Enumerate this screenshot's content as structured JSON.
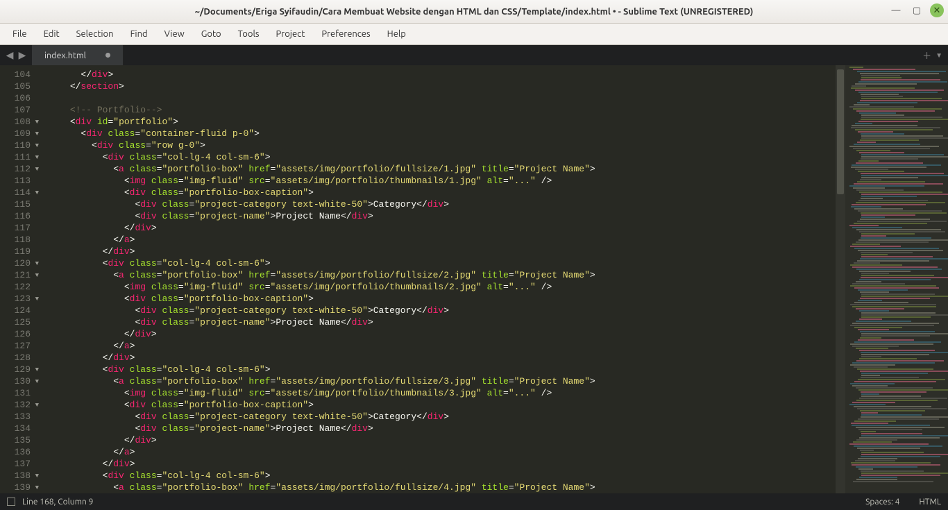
{
  "title": "~/Documents/Eriga Syifaudin/Cara Membuat Website dengan HTML dan CSS/Template/index.html • - Sublime Text (UNREGISTERED)",
  "menu": [
    "File",
    "Edit",
    "Selection",
    "Find",
    "View",
    "Goto",
    "Tools",
    "Project",
    "Preferences",
    "Help"
  ],
  "tab": {
    "name": "index.html"
  },
  "status": {
    "left": "Line 168, Column 9",
    "spaces": "Spaces: 4",
    "lang": "HTML"
  },
  "lineStart": 104,
  "lineEnd": 139,
  "code": [
    {
      "i": 104,
      "indent": 8,
      "t": [
        {
          "p": "</"
        },
        {
          "tg": "div"
        },
        {
          "p": ">"
        }
      ]
    },
    {
      "i": 105,
      "indent": 6,
      "t": [
        {
          "p": "</"
        },
        {
          "tg": "section"
        },
        {
          "p": ">"
        }
      ]
    },
    {
      "i": 106,
      "indent": 0,
      "t": []
    },
    {
      "i": 107,
      "indent": 6,
      "t": [
        {
          "cm": "<!-- Portfolio-->"
        }
      ]
    },
    {
      "i": 108,
      "indent": 6,
      "fold": true,
      "t": [
        {
          "p": "<"
        },
        {
          "tg": "div"
        },
        {
          "p": " "
        },
        {
          "at": "id"
        },
        {
          "p": "="
        },
        {
          "st": "\"portfolio\""
        },
        {
          "p": ">"
        }
      ]
    },
    {
      "i": 109,
      "indent": 8,
      "fold": true,
      "t": [
        {
          "p": "<"
        },
        {
          "tg": "div"
        },
        {
          "p": " "
        },
        {
          "at": "class"
        },
        {
          "p": "="
        },
        {
          "st": "\"container-fluid p-0\""
        },
        {
          "p": ">"
        }
      ]
    },
    {
      "i": 110,
      "indent": 10,
      "fold": true,
      "t": [
        {
          "p": "<"
        },
        {
          "tg": "div"
        },
        {
          "p": " "
        },
        {
          "at": "class"
        },
        {
          "p": "="
        },
        {
          "st": "\"row g-0\""
        },
        {
          "p": ">"
        }
      ]
    },
    {
      "i": 111,
      "indent": 12,
      "fold": true,
      "t": [
        {
          "p": "<"
        },
        {
          "tg": "div"
        },
        {
          "p": " "
        },
        {
          "at": "class"
        },
        {
          "p": "="
        },
        {
          "st": "\"col-lg-4 col-sm-6\""
        },
        {
          "p": ">"
        }
      ]
    },
    {
      "i": 112,
      "indent": 14,
      "fold": true,
      "t": [
        {
          "p": "<"
        },
        {
          "tg": "a"
        },
        {
          "p": " "
        },
        {
          "at": "class"
        },
        {
          "p": "="
        },
        {
          "st": "\"portfolio-box\""
        },
        {
          "p": " "
        },
        {
          "at": "href"
        },
        {
          "p": "="
        },
        {
          "st": "\"assets/img/portfolio/fullsize/1.jpg\""
        },
        {
          "p": " "
        },
        {
          "at": "title"
        },
        {
          "p": "="
        },
        {
          "st": "\"Project Name\""
        },
        {
          "p": ">"
        }
      ]
    },
    {
      "i": 113,
      "indent": 16,
      "t": [
        {
          "p": "<"
        },
        {
          "tg": "img"
        },
        {
          "p": " "
        },
        {
          "at": "class"
        },
        {
          "p": "="
        },
        {
          "st": "\"img-fluid\""
        },
        {
          "p": " "
        },
        {
          "at": "src"
        },
        {
          "p": "="
        },
        {
          "st": "\"assets/img/portfolio/thumbnails/1.jpg\""
        },
        {
          "p": " "
        },
        {
          "at": "alt"
        },
        {
          "p": "="
        },
        {
          "st": "\"...\""
        },
        {
          "p": " />"
        }
      ]
    },
    {
      "i": 114,
      "indent": 16,
      "fold": true,
      "t": [
        {
          "p": "<"
        },
        {
          "tg": "div"
        },
        {
          "p": " "
        },
        {
          "at": "class"
        },
        {
          "p": "="
        },
        {
          "st": "\"portfolio-box-caption\""
        },
        {
          "p": ">"
        }
      ]
    },
    {
      "i": 115,
      "indent": 18,
      "t": [
        {
          "p": "<"
        },
        {
          "tg": "div"
        },
        {
          "p": " "
        },
        {
          "at": "class"
        },
        {
          "p": "="
        },
        {
          "st": "\"project-category text-white-50\""
        },
        {
          "p": ">"
        },
        {
          "tx": "Category"
        },
        {
          "p": "</"
        },
        {
          "tg": "div"
        },
        {
          "p": ">"
        }
      ]
    },
    {
      "i": 116,
      "indent": 18,
      "t": [
        {
          "p": "<"
        },
        {
          "tg": "div"
        },
        {
          "p": " "
        },
        {
          "at": "class"
        },
        {
          "p": "="
        },
        {
          "st": "\"project-name\""
        },
        {
          "p": ">"
        },
        {
          "tx": "Project Name"
        },
        {
          "p": "</"
        },
        {
          "tg": "div"
        },
        {
          "p": ">"
        }
      ]
    },
    {
      "i": 117,
      "indent": 16,
      "t": [
        {
          "p": "</"
        },
        {
          "tg": "div"
        },
        {
          "p": ">"
        }
      ]
    },
    {
      "i": 118,
      "indent": 14,
      "t": [
        {
          "p": "</"
        },
        {
          "tg": "a"
        },
        {
          "p": ">"
        }
      ]
    },
    {
      "i": 119,
      "indent": 12,
      "t": [
        {
          "p": "</"
        },
        {
          "tg": "div"
        },
        {
          "p": ">"
        }
      ]
    },
    {
      "i": 120,
      "indent": 12,
      "fold": true,
      "t": [
        {
          "p": "<"
        },
        {
          "tg": "div"
        },
        {
          "p": " "
        },
        {
          "at": "class"
        },
        {
          "p": "="
        },
        {
          "st": "\"col-lg-4 col-sm-6\""
        },
        {
          "p": ">"
        }
      ]
    },
    {
      "i": 121,
      "indent": 14,
      "fold": true,
      "t": [
        {
          "p": "<"
        },
        {
          "tg": "a"
        },
        {
          "p": " "
        },
        {
          "at": "class"
        },
        {
          "p": "="
        },
        {
          "st": "\"portfolio-box\""
        },
        {
          "p": " "
        },
        {
          "at": "href"
        },
        {
          "p": "="
        },
        {
          "st": "\"assets/img/portfolio/fullsize/2.jpg\""
        },
        {
          "p": " "
        },
        {
          "at": "title"
        },
        {
          "p": "="
        },
        {
          "st": "\"Project Name\""
        },
        {
          "p": ">"
        }
      ]
    },
    {
      "i": 122,
      "indent": 16,
      "t": [
        {
          "p": "<"
        },
        {
          "tg": "img"
        },
        {
          "p": " "
        },
        {
          "at": "class"
        },
        {
          "p": "="
        },
        {
          "st": "\"img-fluid\""
        },
        {
          "p": " "
        },
        {
          "at": "src"
        },
        {
          "p": "="
        },
        {
          "st": "\"assets/img/portfolio/thumbnails/2.jpg\""
        },
        {
          "p": " "
        },
        {
          "at": "alt"
        },
        {
          "p": "="
        },
        {
          "st": "\"...\""
        },
        {
          "p": " />"
        }
      ]
    },
    {
      "i": 123,
      "indent": 16,
      "fold": true,
      "t": [
        {
          "p": "<"
        },
        {
          "tg": "div"
        },
        {
          "p": " "
        },
        {
          "at": "class"
        },
        {
          "p": "="
        },
        {
          "st": "\"portfolio-box-caption\""
        },
        {
          "p": ">"
        }
      ]
    },
    {
      "i": 124,
      "indent": 18,
      "t": [
        {
          "p": "<"
        },
        {
          "tg": "div"
        },
        {
          "p": " "
        },
        {
          "at": "class"
        },
        {
          "p": "="
        },
        {
          "st": "\"project-category text-white-50\""
        },
        {
          "p": ">"
        },
        {
          "tx": "Category"
        },
        {
          "p": "</"
        },
        {
          "tg": "div"
        },
        {
          "p": ">"
        }
      ]
    },
    {
      "i": 125,
      "indent": 18,
      "t": [
        {
          "p": "<"
        },
        {
          "tg": "div"
        },
        {
          "p": " "
        },
        {
          "at": "class"
        },
        {
          "p": "="
        },
        {
          "st": "\"project-name\""
        },
        {
          "p": ">"
        },
        {
          "tx": "Project Name"
        },
        {
          "p": "</"
        },
        {
          "tg": "div"
        },
        {
          "p": ">"
        }
      ]
    },
    {
      "i": 126,
      "indent": 16,
      "t": [
        {
          "p": "</"
        },
        {
          "tg": "div"
        },
        {
          "p": ">"
        }
      ]
    },
    {
      "i": 127,
      "indent": 14,
      "t": [
        {
          "p": "</"
        },
        {
          "tg": "a"
        },
        {
          "p": ">"
        }
      ]
    },
    {
      "i": 128,
      "indent": 12,
      "t": [
        {
          "p": "</"
        },
        {
          "tg": "div"
        },
        {
          "p": ">"
        }
      ]
    },
    {
      "i": 129,
      "indent": 12,
      "fold": true,
      "t": [
        {
          "p": "<"
        },
        {
          "tg": "div"
        },
        {
          "p": " "
        },
        {
          "at": "class"
        },
        {
          "p": "="
        },
        {
          "st": "\"col-lg-4 col-sm-6\""
        },
        {
          "p": ">"
        }
      ]
    },
    {
      "i": 130,
      "indent": 14,
      "fold": true,
      "t": [
        {
          "p": "<"
        },
        {
          "tg": "a"
        },
        {
          "p": " "
        },
        {
          "at": "class"
        },
        {
          "p": "="
        },
        {
          "st": "\"portfolio-box\""
        },
        {
          "p": " "
        },
        {
          "at": "href"
        },
        {
          "p": "="
        },
        {
          "st": "\"assets/img/portfolio/fullsize/3.jpg\""
        },
        {
          "p": " "
        },
        {
          "at": "title"
        },
        {
          "p": "="
        },
        {
          "st": "\"Project Name\""
        },
        {
          "p": ">"
        }
      ]
    },
    {
      "i": 131,
      "indent": 16,
      "t": [
        {
          "p": "<"
        },
        {
          "tg": "img"
        },
        {
          "p": " "
        },
        {
          "at": "class"
        },
        {
          "p": "="
        },
        {
          "st": "\"img-fluid\""
        },
        {
          "p": " "
        },
        {
          "at": "src"
        },
        {
          "p": "="
        },
        {
          "st": "\"assets/img/portfolio/thumbnails/3.jpg\""
        },
        {
          "p": " "
        },
        {
          "at": "alt"
        },
        {
          "p": "="
        },
        {
          "st": "\"...\""
        },
        {
          "p": " />"
        }
      ]
    },
    {
      "i": 132,
      "indent": 16,
      "fold": true,
      "t": [
        {
          "p": "<"
        },
        {
          "tg": "div"
        },
        {
          "p": " "
        },
        {
          "at": "class"
        },
        {
          "p": "="
        },
        {
          "st": "\"portfolio-box-caption\""
        },
        {
          "p": ">"
        }
      ]
    },
    {
      "i": 133,
      "indent": 18,
      "t": [
        {
          "p": "<"
        },
        {
          "tg": "div"
        },
        {
          "p": " "
        },
        {
          "at": "class"
        },
        {
          "p": "="
        },
        {
          "st": "\"project-category text-white-50\""
        },
        {
          "p": ">"
        },
        {
          "tx": "Category"
        },
        {
          "p": "</"
        },
        {
          "tg": "div"
        },
        {
          "p": ">"
        }
      ]
    },
    {
      "i": 134,
      "indent": 18,
      "t": [
        {
          "p": "<"
        },
        {
          "tg": "div"
        },
        {
          "p": " "
        },
        {
          "at": "class"
        },
        {
          "p": "="
        },
        {
          "st": "\"project-name\""
        },
        {
          "p": ">"
        },
        {
          "tx": "Project Name"
        },
        {
          "p": "</"
        },
        {
          "tg": "div"
        },
        {
          "p": ">"
        }
      ]
    },
    {
      "i": 135,
      "indent": 16,
      "t": [
        {
          "p": "</"
        },
        {
          "tg": "div"
        },
        {
          "p": ">"
        }
      ]
    },
    {
      "i": 136,
      "indent": 14,
      "t": [
        {
          "p": "</"
        },
        {
          "tg": "a"
        },
        {
          "p": ">"
        }
      ]
    },
    {
      "i": 137,
      "indent": 12,
      "t": [
        {
          "p": "</"
        },
        {
          "tg": "div"
        },
        {
          "p": ">"
        }
      ]
    },
    {
      "i": 138,
      "indent": 12,
      "fold": true,
      "t": [
        {
          "p": "<"
        },
        {
          "tg": "div"
        },
        {
          "p": " "
        },
        {
          "at": "class"
        },
        {
          "p": "="
        },
        {
          "st": "\"col-lg-4 col-sm-6\""
        },
        {
          "p": ">"
        }
      ]
    },
    {
      "i": 139,
      "indent": 14,
      "fold": true,
      "t": [
        {
          "p": "<"
        },
        {
          "tg": "a"
        },
        {
          "p": " "
        },
        {
          "at": "class"
        },
        {
          "p": "="
        },
        {
          "st": "\"portfolio-box\""
        },
        {
          "p": " "
        },
        {
          "at": "href"
        },
        {
          "p": "="
        },
        {
          "st": "\"assets/img/portfolio/fullsize/4.jpg\""
        },
        {
          "p": " "
        },
        {
          "at": "title"
        },
        {
          "p": "="
        },
        {
          "st": "\"Project Name\""
        },
        {
          "p": ">"
        }
      ]
    }
  ]
}
